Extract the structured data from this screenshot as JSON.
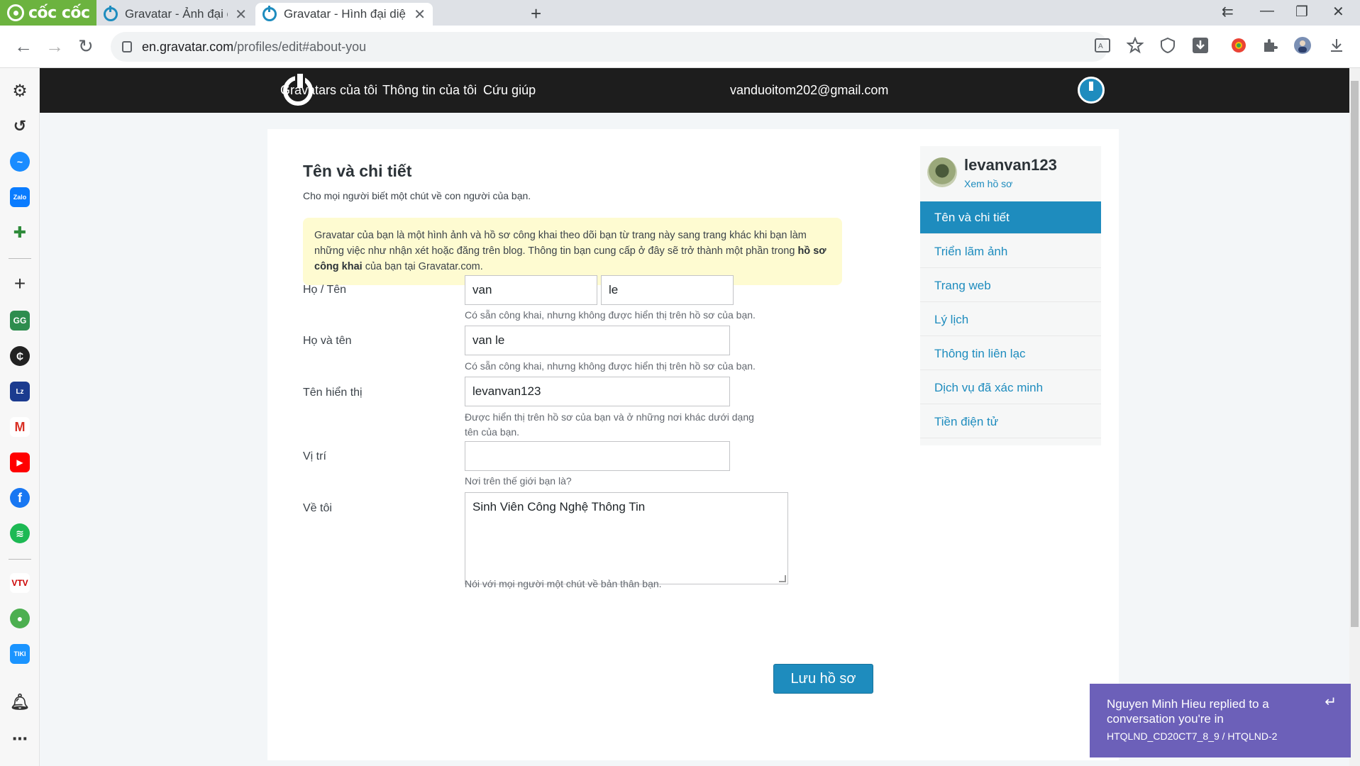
{
  "browser": {
    "brand": "cốc cốc",
    "tabs": [
      {
        "title": "Gravatar - Ảnh đại diện toàn c",
        "active": false
      },
      {
        "title": "Gravatar - Hình đại diện được",
        "active": true
      }
    ],
    "url_host": "en.gravatar.com",
    "url_path": "/profiles/edit#about-you"
  },
  "site_nav": {
    "items": [
      "Gravatars của tôi",
      "Thông tin của tôi",
      "Cứu giúp"
    ],
    "account_email": "vanduoitom202@gmail.com"
  },
  "form": {
    "title": "Tên và chi tiết",
    "subtitle": "Cho mọi người biết một chút về con người của bạn.",
    "notice_part1": "Gravatar của bạn là một hình ảnh và hồ sơ công khai theo dõi bạn từ trang này sang trang khác khi bạn làm những việc như nhận xét hoặc đăng trên blog. Thông tin bạn cung cấp ở đây sẽ trở thành một phần trong ",
    "notice_bold": "hồ sơ công khai",
    "notice_part2": " của bạn tại Gravatar.com.",
    "fields": {
      "name_label": "Họ / Tên",
      "first_name": "van",
      "last_name": "le",
      "name_hint": "Có sẵn công khai, nhưng không được hiển thị trên hồ sơ của bạn.",
      "fullname_label": "Họ và tên",
      "full_name": "van le",
      "fullname_hint": "Có sẵn công khai, nhưng không được hiển thị trên hồ sơ của bạn.",
      "display_label": "Tên hiển thị",
      "display_name": "levanvan123",
      "display_hint": "Được hiển thị trên hồ sơ của bạn và ở những nơi khác dưới dạng tên của bạn.",
      "location_label": "Vị trí",
      "location": "",
      "location_hint": "Nơi trên thế giới bạn là?",
      "about_label": "Về tôi",
      "about": "Sinh Viên Công Nghệ Thông Tin",
      "about_hint": "Nói với mọi người một chút về bản thân bạn."
    },
    "save_label": "Lưu hồ sơ"
  },
  "profile": {
    "username": "levanvan123",
    "view_link": "Xem hồ sơ",
    "menu": [
      "Tên và chi tiết",
      "Triển lãm ảnh",
      "Trang web",
      "Lý lịch",
      "Thông tin liên lạc",
      "Dịch vụ đã xác minh",
      "Tiền điện tử"
    ]
  },
  "toast": {
    "line1": "Nguyen Minh Hieu replied to a conversation you're in",
    "line2": "HTQLND_CD20CT7_8_9 / HTQLND-2"
  },
  "colors": {
    "accent": "#1e8cbe",
    "brand": "#6cb33f",
    "notice_bg": "#fefbd1",
    "toast_bg": "#6c60b9"
  }
}
